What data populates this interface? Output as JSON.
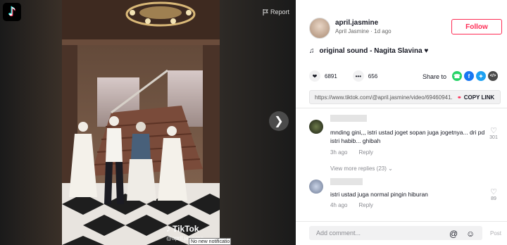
{
  "video": {
    "report_label": "Report",
    "watermark_brand": "TikTok",
    "watermark_user": "@april.jasmine"
  },
  "author": {
    "username": "april.jasmine",
    "nickname": "April Jasmine",
    "posted": "1d ago",
    "follow_label": "Follow"
  },
  "sound": {
    "title": "original sound - Nagita Slavina ♥"
  },
  "stats": {
    "likes": "6891",
    "comments": "656",
    "share_label": "Share to"
  },
  "link": {
    "url": "https://www.tiktok.com/@april.jasmine/video/69460941...",
    "copy_label": "COPY LINK"
  },
  "comments": [
    {
      "text": "mnding gini,,, istri ustad joget sopan juga jogetnya... dri pd istri habib... ghibah",
      "time": "3h ago",
      "reply_label": "Reply",
      "likes": "301"
    },
    {
      "text": "istri ustad juga normal pingin hiburan",
      "time": "4h ago",
      "reply_label": "Reply",
      "likes": "89"
    }
  ],
  "view_more": "View more replies (23) ⌄",
  "composer": {
    "placeholder": "Add comment...",
    "post_label": "Post"
  },
  "notification": "No new notificatio",
  "colors": {
    "accent": "#fe2c55",
    "whatsapp": "#25d366",
    "facebook": "#1877f2",
    "twitter": "#1da1f2",
    "embed": "#4a4a4a"
  }
}
